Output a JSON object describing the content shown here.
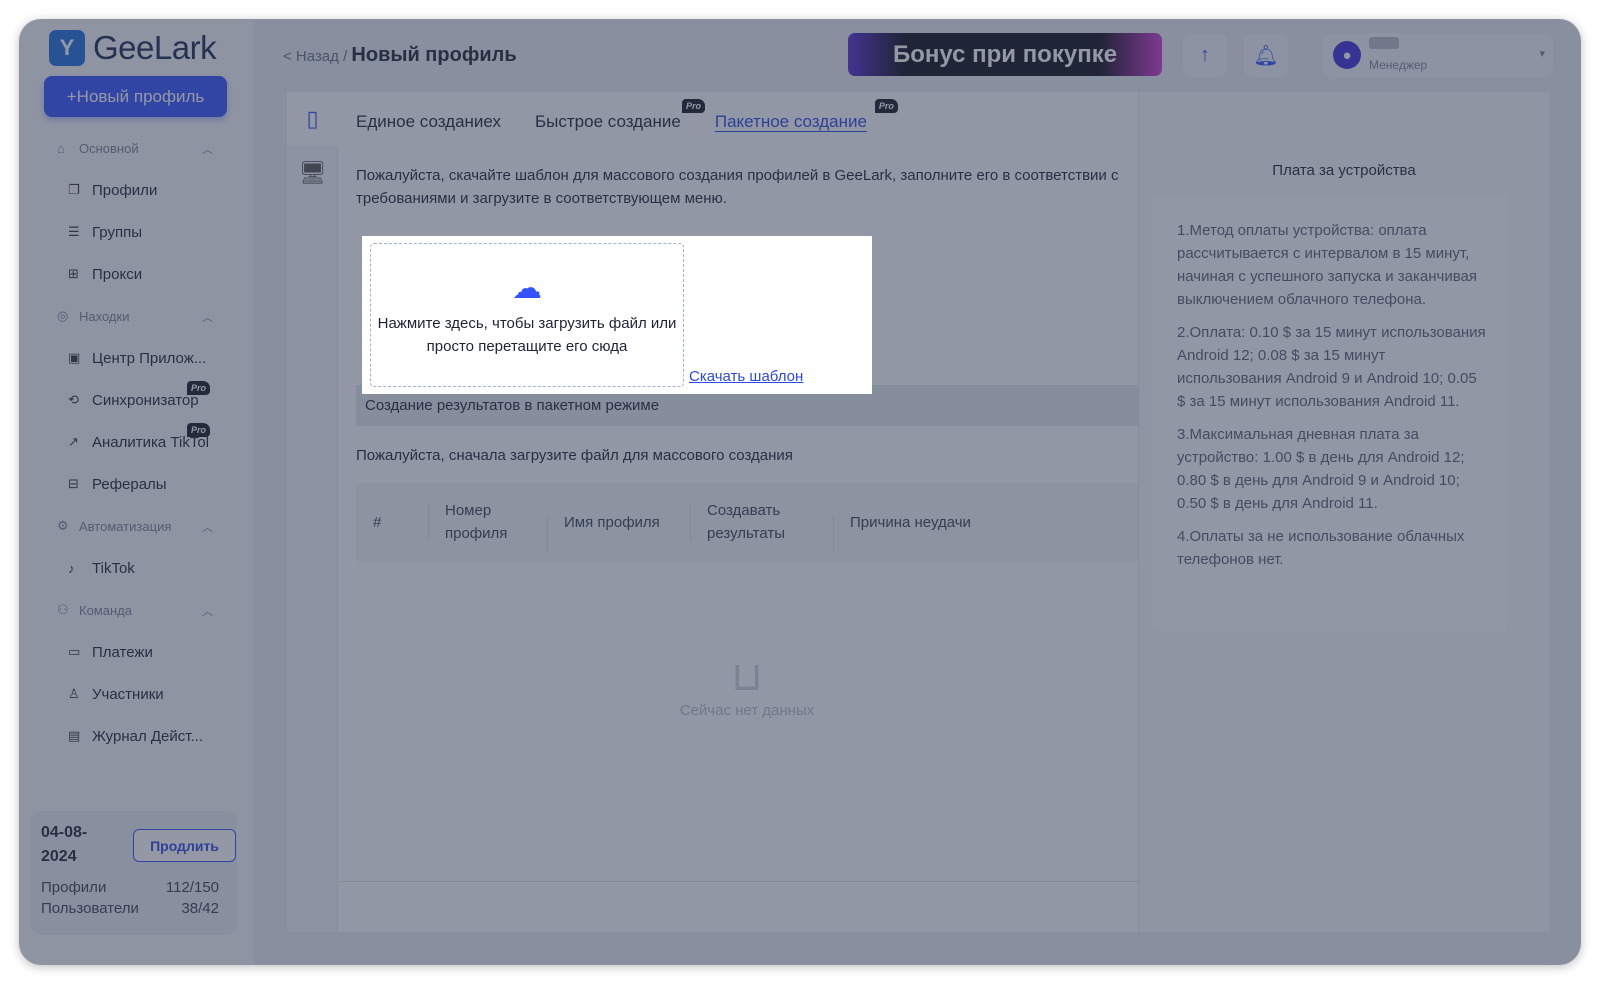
{
  "app": {
    "logo_text": "GeeLark"
  },
  "sidebar": {
    "new_profile_label": "+Новый профиль",
    "sections": [
      {
        "label": "Основной",
        "items": [
          "Профили",
          "Группы",
          "Прокси"
        ]
      },
      {
        "label": "Находки",
        "items": [
          "Центр Прилож...",
          "Синхронизатор",
          "Аналитика TikTok",
          "Рефералы"
        ]
      },
      {
        "label": "Автоматизация",
        "items": [
          "TikTok"
        ]
      },
      {
        "label": "Команда",
        "items": [
          "Платежи",
          "Участники",
          "Журнал Дейст..."
        ]
      }
    ],
    "pro_badge": "Pro",
    "plan": {
      "date": "04-08-2024",
      "extend_label": "Продлить",
      "profiles_label": "Профили",
      "profiles_value": "112/150",
      "users_label": "Пользователи",
      "users_value": "38/42"
    }
  },
  "header": {
    "back_label": "< Назад /",
    "title": "Новый профиль",
    "banner": "Бонус при покупке",
    "user_role": "Менеджер"
  },
  "tabs": [
    {
      "label": "Единое созданиех"
    },
    {
      "label": "Быстрое создание",
      "badge": "Pro"
    },
    {
      "label": "Пакетное создание",
      "badge": "Pro"
    }
  ],
  "main": {
    "description": "Пожалуйста, скачайте шаблон для массового создания профилей в GeeLark, заполните его в соответствии с требованиями и загрузите в соответствующем меню.",
    "upload_text": "Нажмите здесь, чтобы загрузить файл или просто перетащите его сюда",
    "download_template": "Скачать шаблон",
    "results_title": "Создание результатов в пакетном режиме",
    "upload_first_hint": "Пожалуйста, сначала загрузите файл для массового создания",
    "table_headers": [
      "#",
      "Номер профиля",
      "Имя профиля",
      "Создавать результаты",
      "Причина неудачи"
    ],
    "empty_text": "Сейчас нет данных"
  },
  "fees": {
    "title": "Плата за устройства",
    "items": [
      "1.Метод оплаты устройства: оплата рассчитывается с интервалом в 15 минут, начиная с успешного запуска и заканчивая выключением облачного телефона.",
      "2.Оплата: 0.10 $ за 15 минут использования Android 12; 0.08 $ за 15 минут использования Android 9 и Android 10; 0.05 $ за 15 минут использования Android 11.",
      "3.Максимальная дневная плата за устройство: 1.00 $ в день для Android 12; 0.80 $ в день для Android 9 и Android 10; 0.50 $ в день для Android 11.",
      "4.Оплаты за не использование облачных телефонов нет."
    ]
  }
}
